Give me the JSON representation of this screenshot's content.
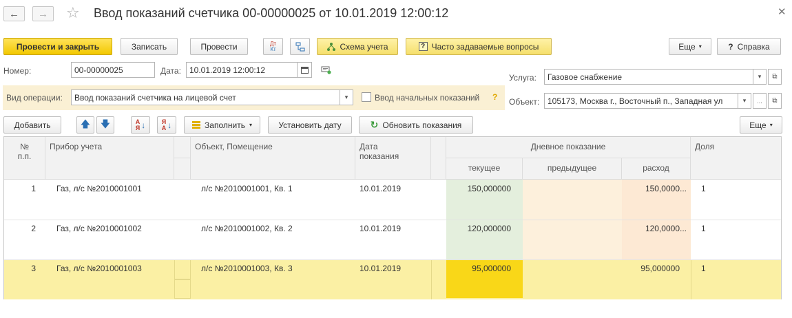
{
  "title": "Ввод показаний счетчика 00-00000025 от 10.01.2019 12:00:12",
  "toolbar": {
    "post_close": "Провести и закрыть",
    "save": "Записать",
    "post": "Провести",
    "dt_kt": "Дт Кт",
    "scheme": "Схема учета",
    "faq": "Часто задаваемые вопросы",
    "more": "Еще",
    "help": "Справка"
  },
  "form": {
    "number_label": "Номер:",
    "number_value": "00-00000025",
    "date_label": "Дата:",
    "date_value": "10.01.2019 12:00:12",
    "operation_label": "Вид операции:",
    "operation_value": "Ввод показаний счетчика на лицевой счет",
    "initial_label": "Ввод начальных показаний",
    "initial_help": "?",
    "service_label": "Услуга:",
    "service_value": "Газовое снабжение",
    "object_label": "Объект:",
    "object_value": "105173, Москва г., Восточный п., Западная ул",
    "object_dots": "..."
  },
  "table_toolbar": {
    "add": "Добавить",
    "fill": "Заполнить",
    "set_date": "Установить дату",
    "refresh": "Обновить показания",
    "more": "Еще"
  },
  "table": {
    "headers": {
      "num": "№ п.п.",
      "device": "Прибор учета",
      "object": "Объект, Помещение",
      "date": "Дата показания",
      "day": "Дневное показание",
      "current": "текущее",
      "previous": "предыдущее",
      "consumption": "расход",
      "share": "Доля"
    },
    "rows": [
      {
        "num": "1",
        "device": "Газ, л/с №2010001001",
        "object": "л/с №2010001001, Кв. 1",
        "date": "10.01.2019",
        "current": "150,000000",
        "previous": "",
        "consumption": "150,0000...",
        "share": "1"
      },
      {
        "num": "2",
        "device": "Газ, л/с №2010001002",
        "object": "л/с №2010001002, Кв. 2",
        "date": "10.01.2019",
        "current": "120,000000",
        "previous": "",
        "consumption": "120,0000...",
        "share": "1"
      },
      {
        "num": "3",
        "device": "Газ, л/с №2010001003",
        "object": "л/с №2010001003, Кв. 3",
        "date": "10.01.2019",
        "current": "95,000000",
        "previous": "",
        "consumption": "95,000000",
        "share": "1"
      }
    ]
  },
  "colors": {
    "accent_yellow": "#f5cd0e",
    "selected_row": "#fbf0a4",
    "current_col": "#e4efdd",
    "previous_col": "#fdf0dc",
    "consumption_col": "#fde9d4",
    "selected_current": "#f9d718"
  },
  "icons": [
    "back-arrow-icon",
    "forward-arrow-icon",
    "favorite-star-icon",
    "close-icon",
    "dt-kt-icon",
    "structure-icon",
    "scheme-icon",
    "help-icon",
    "calendar-icon",
    "comment-icon",
    "dropdown-icon",
    "open-icon",
    "move-up-icon",
    "move-down-icon",
    "sort-asc-icon",
    "sort-desc-icon",
    "fill-icon",
    "refresh-icon"
  ]
}
